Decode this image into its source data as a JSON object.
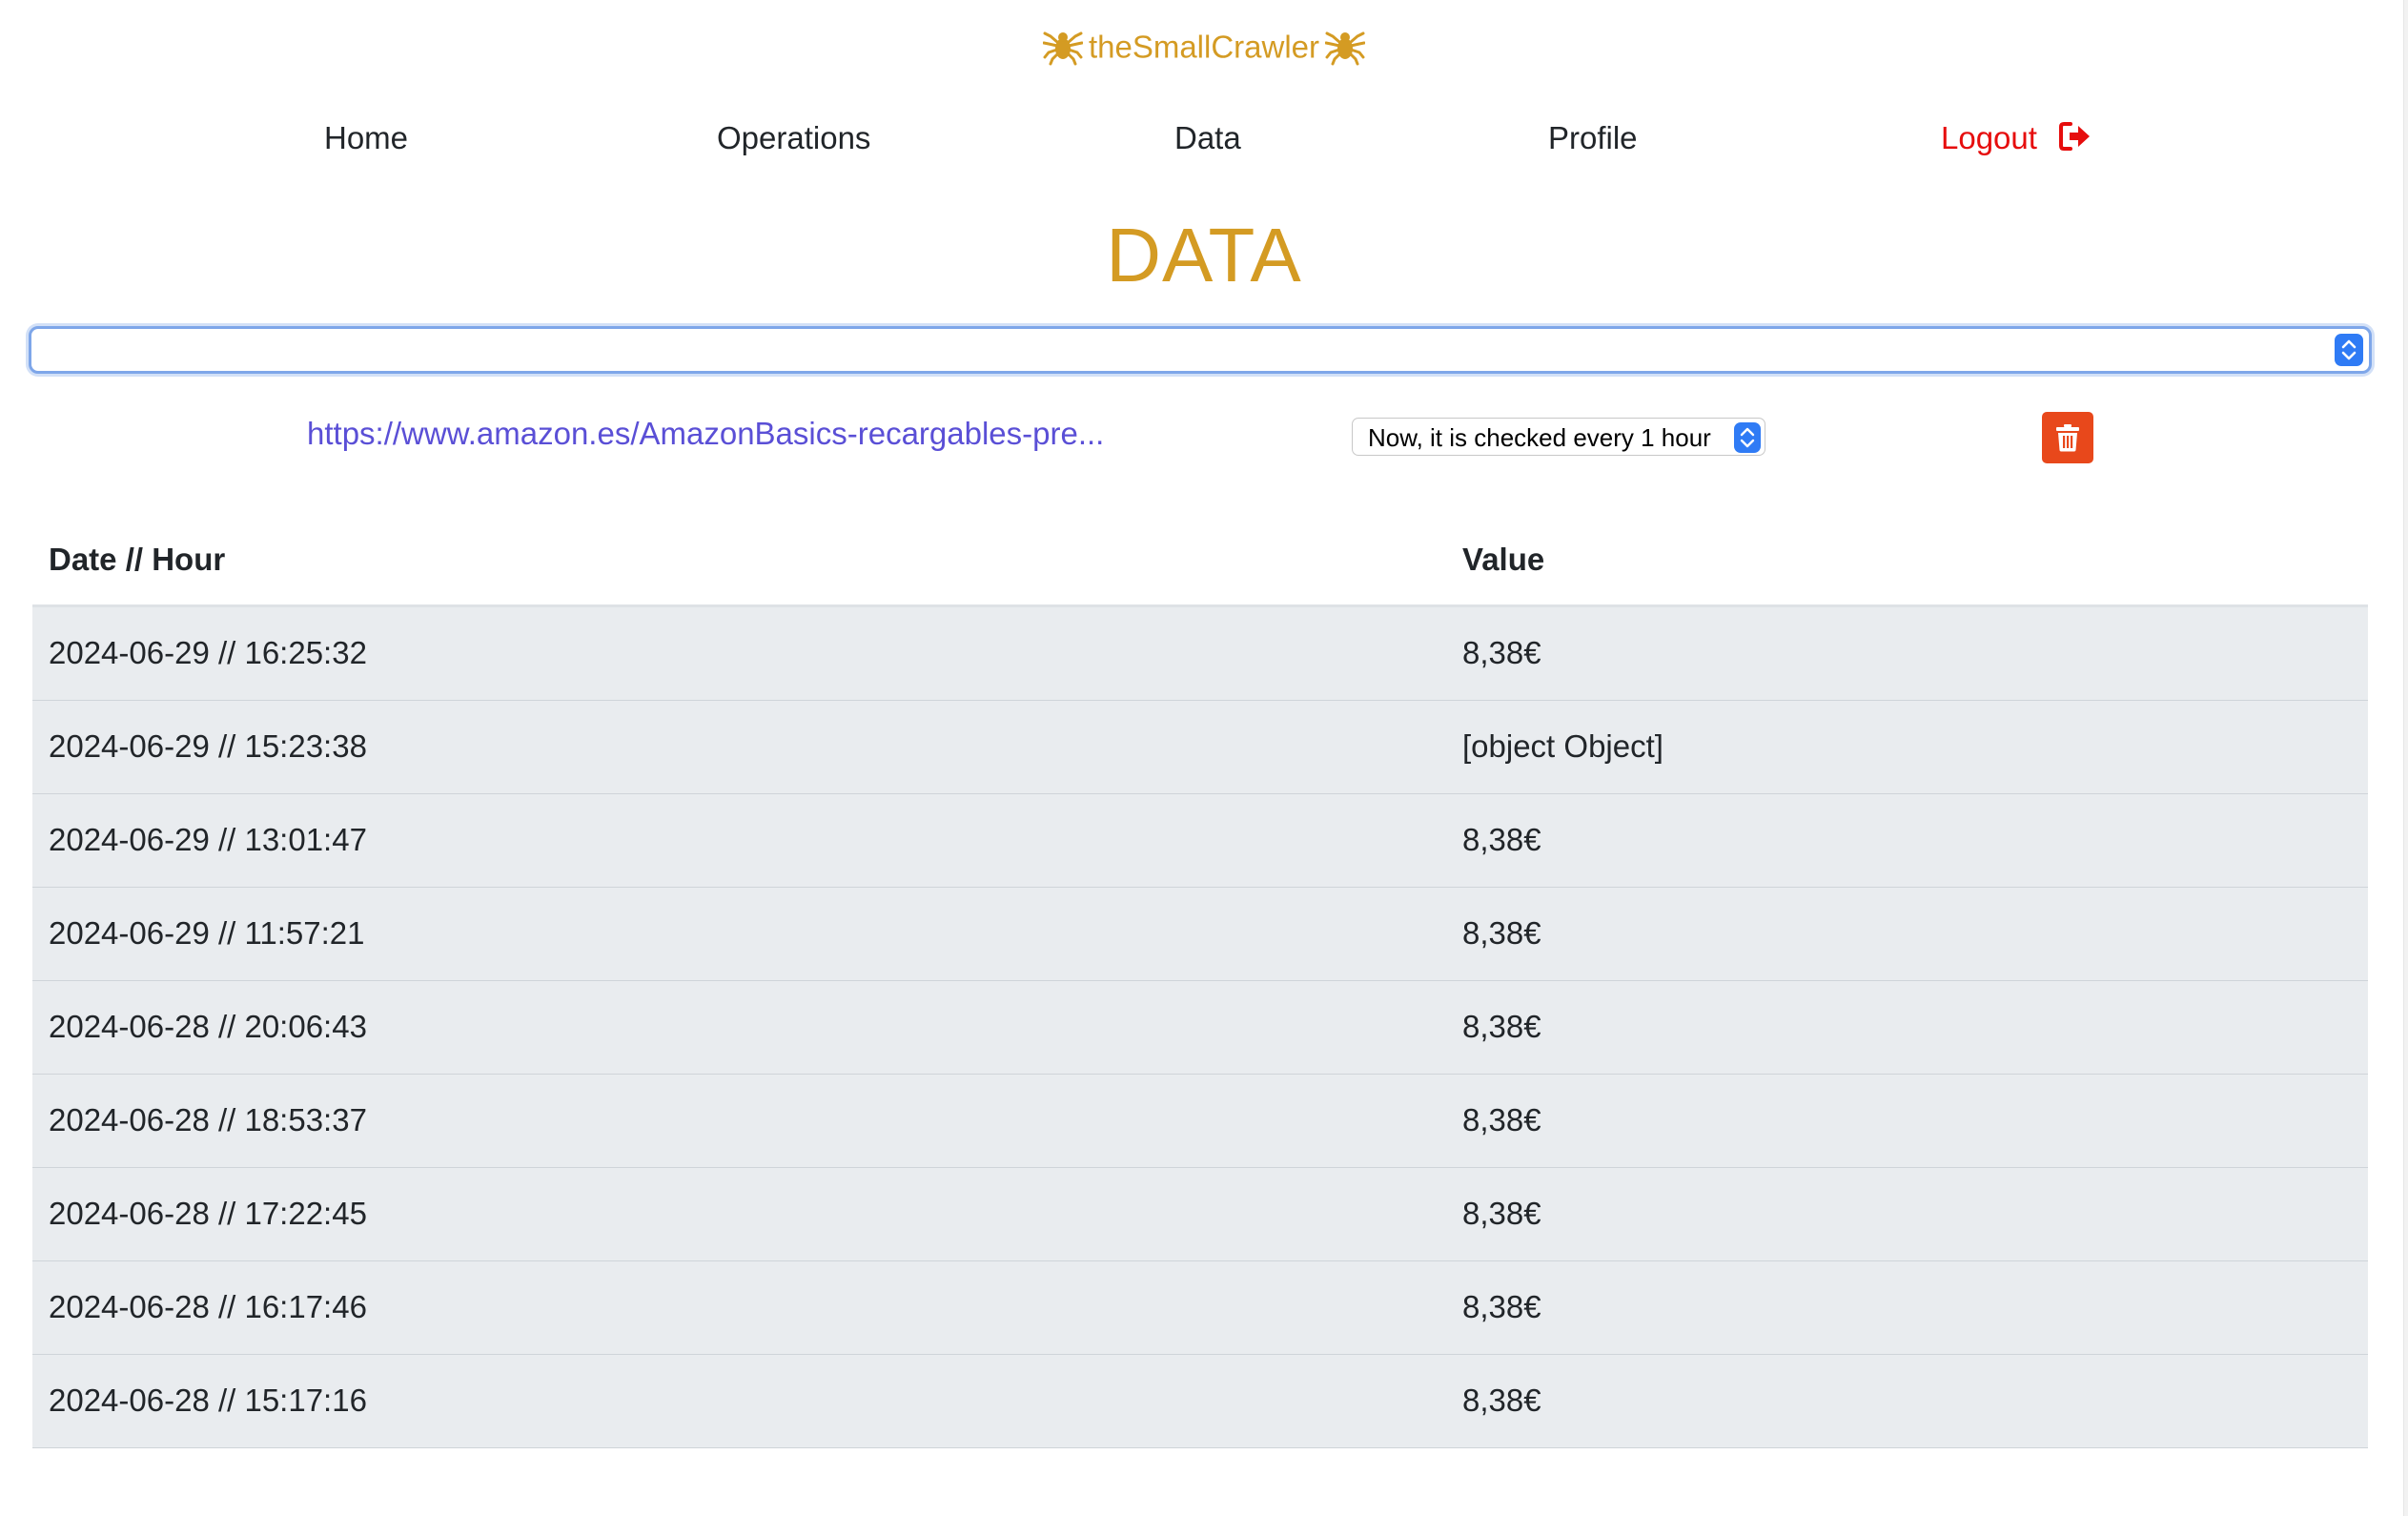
{
  "brand": {
    "name": "theSmallCrawler",
    "color": "#d49b23",
    "icon": "spider-icon"
  },
  "nav": {
    "home": "Home",
    "operations": "Operations",
    "data": "Data",
    "profile": "Profile",
    "logout": "Logout",
    "logout_icon": "sign-out-icon",
    "logout_color": "#e60d0d"
  },
  "page": {
    "title": "DATA"
  },
  "url_select": {
    "value": ""
  },
  "item": {
    "url": "https://www.amazon.es/AmazonBasics-recargables-pre...",
    "frequency": "Now, it is checked every 1 hour",
    "delete_icon": "trash-icon",
    "delete_color": "#e8481b"
  },
  "table": {
    "headers": {
      "date": "Date // Hour",
      "value": "Value"
    },
    "rows": [
      {
        "date": "2024-06-29 // 16:25:32",
        "value": "8,38€"
      },
      {
        "date": "2024-06-29 // 15:23:38",
        "value": "[object Object]"
      },
      {
        "date": "2024-06-29 // 13:01:47",
        "value": "8,38€"
      },
      {
        "date": "2024-06-29 // 11:57:21",
        "value": "8,38€"
      },
      {
        "date": "2024-06-28 // 20:06:43",
        "value": "8,38€"
      },
      {
        "date": "2024-06-28 // 18:53:37",
        "value": "8,38€"
      },
      {
        "date": "2024-06-28 // 17:22:45",
        "value": "8,38€"
      },
      {
        "date": "2024-06-28 // 16:17:46",
        "value": "8,38€"
      },
      {
        "date": "2024-06-28 // 15:17:16",
        "value": "8,38€"
      }
    ]
  }
}
